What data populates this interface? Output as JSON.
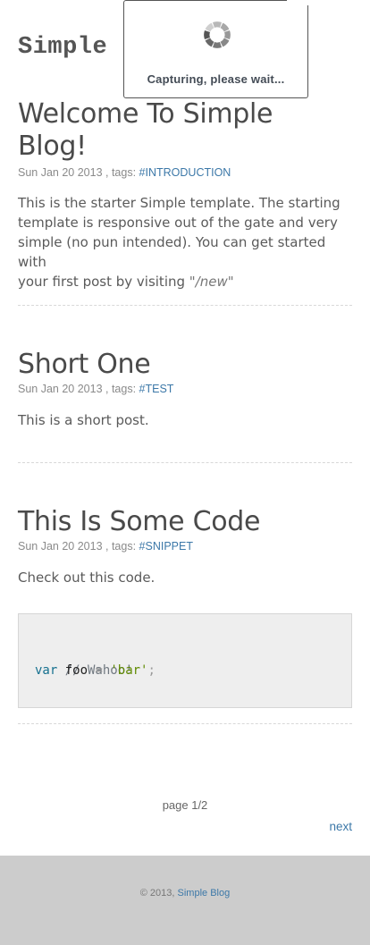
{
  "site": {
    "logo": "Simple"
  },
  "overlay": {
    "message": "Capturing, please wait..."
  },
  "posts": [
    {
      "title_lines": [
        "Welcome To Simple",
        "Blog!"
      ],
      "date": "Sun Jan 20 2013",
      "tags_label": ", tags:",
      "tag": "#INTRODUCTION",
      "body_lines": [
        "This is the starter Simple template. The starting",
        "template is responsive out of the gate and very",
        "simple (no pun intended). You can get started with"
      ],
      "body_last_prefix": "your first post by visiting ",
      "body_last_em": "\"/new\""
    },
    {
      "title": "Short One",
      "date": "Sun Jan 20 2013",
      "tags_label": ", tags:",
      "tag": "#TEST",
      "body": "This is a short post."
    },
    {
      "title": "This Is Some Code",
      "date": "Sun Jan 20 2013",
      "tags_label": ", tags:",
      "tag": "#SNIPPET",
      "body": "Check out this code.",
      "code": {
        "comment": "// Wahoo!",
        "keyword": "var",
        "identifier": "foo",
        "operator": "=",
        "string": "'bar'",
        "terminator": ";"
      }
    }
  ],
  "pagination": {
    "label": "page 1/2",
    "next": "next"
  },
  "footer": {
    "copyright": "© 2013,",
    "link": "Simple Blog"
  },
  "colors": {
    "link": "#3c78a8",
    "footer_bg": "#cccccc",
    "code_bg": "#eeeeee"
  }
}
